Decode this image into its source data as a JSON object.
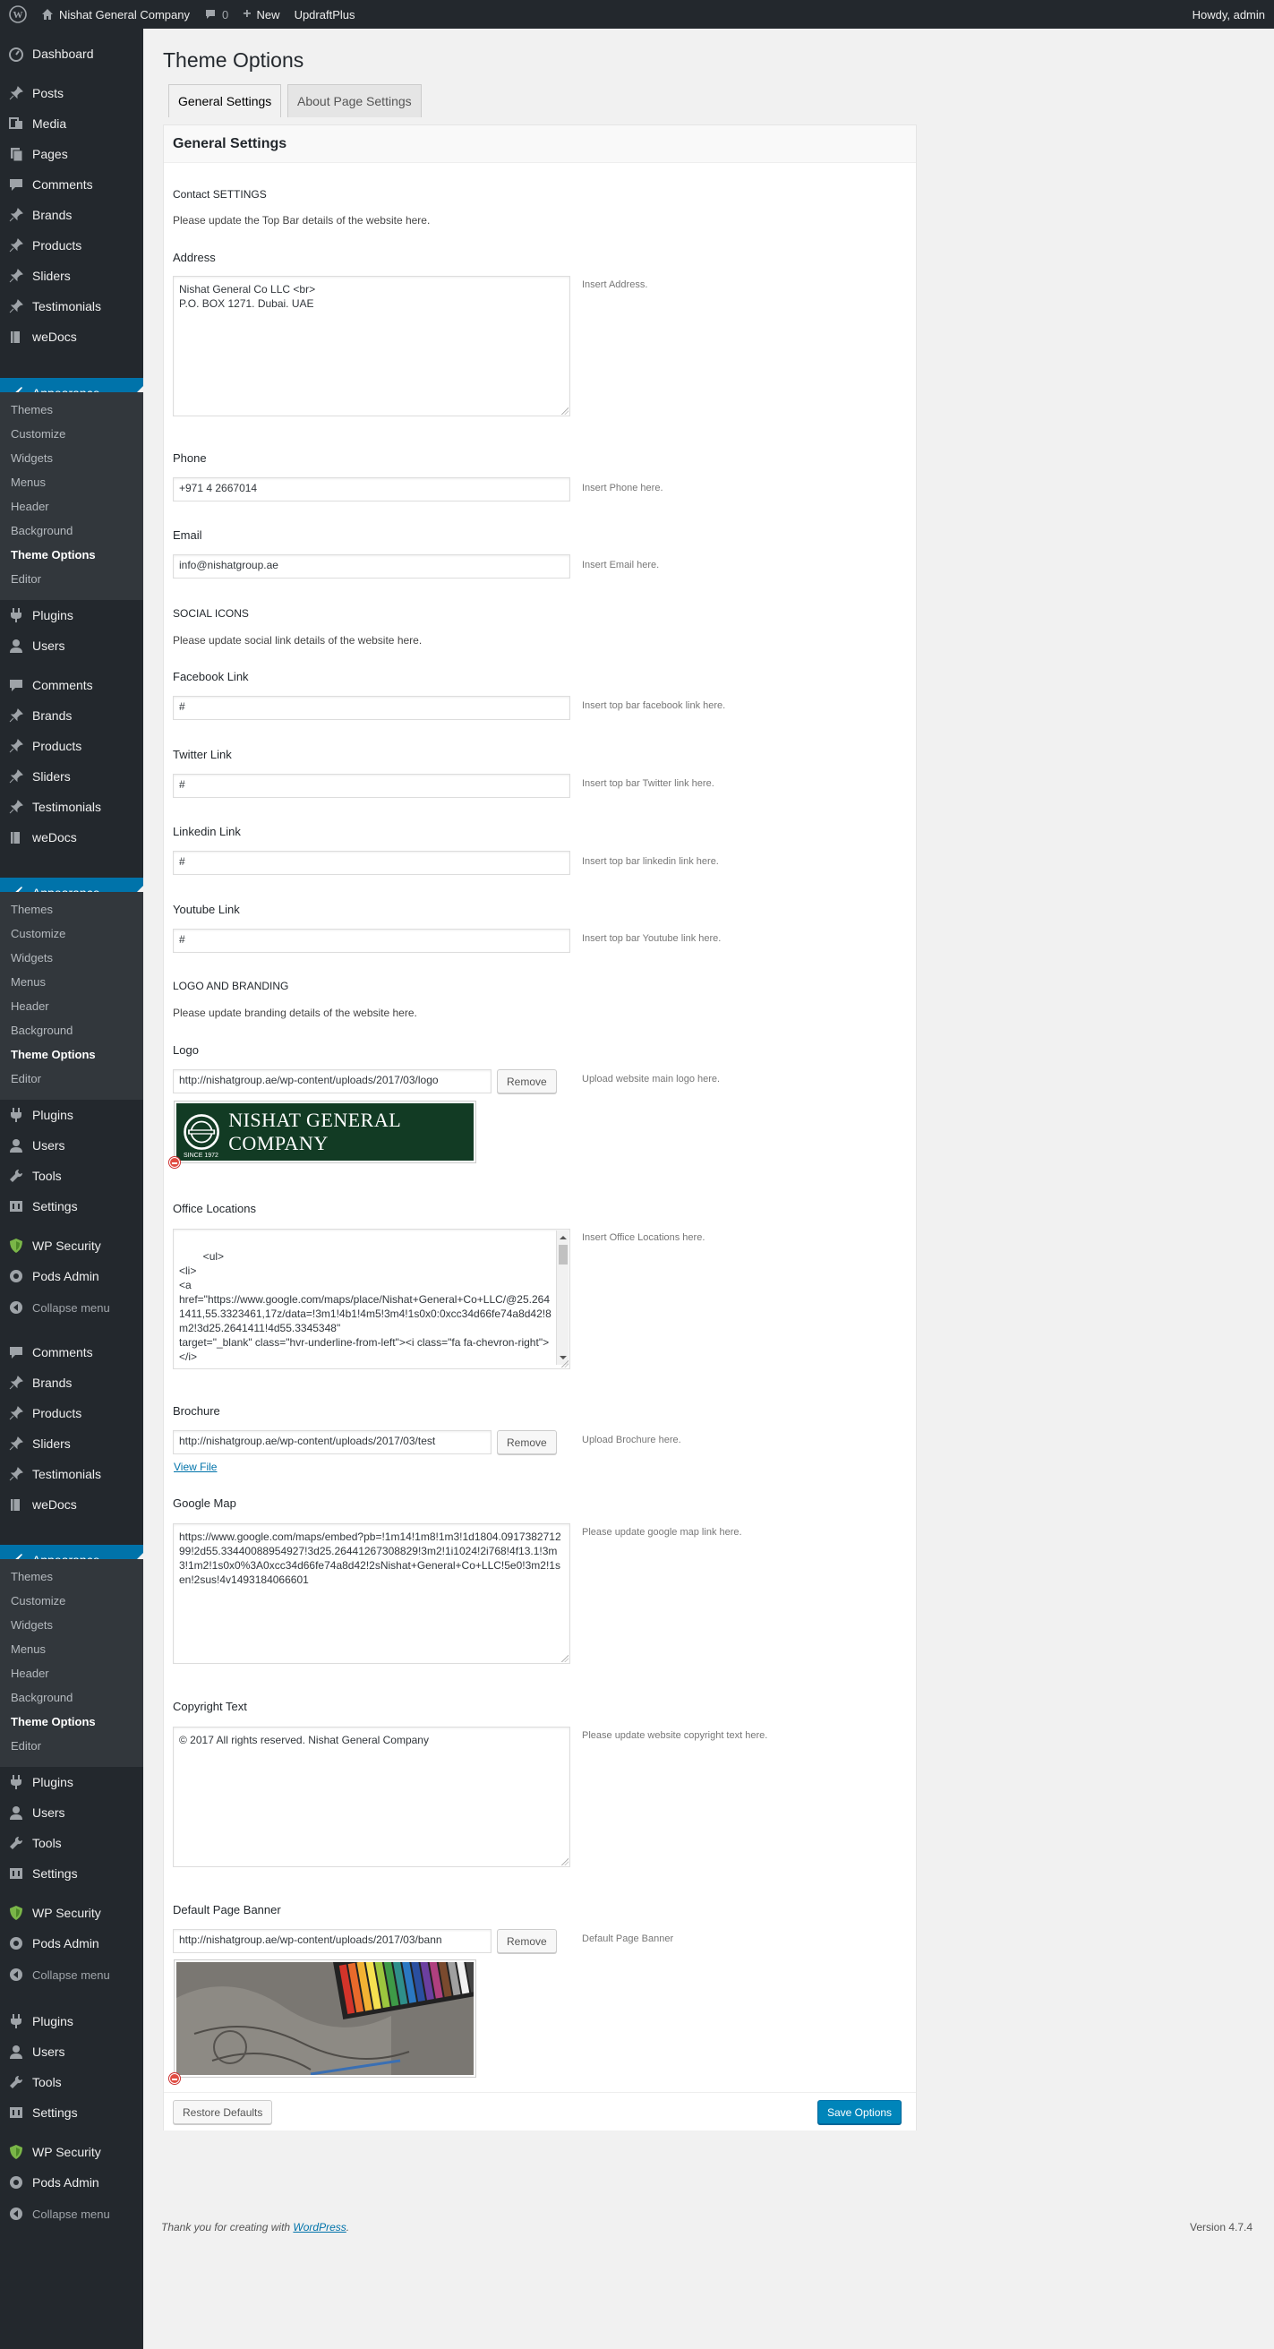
{
  "adminbar": {
    "site_name": "Nishat General Company",
    "comments_count": "0",
    "new_label": "New",
    "plugin_label": "UpdraftPlus",
    "howdy": "Howdy, admin"
  },
  "sidebar": {
    "group1": [
      "Dashboard",
      "Posts",
      "Media",
      "Pages",
      "Comments",
      "Brands",
      "Products",
      "Sliders",
      "Testimonials",
      "weDocs"
    ],
    "appearance": "Appearance",
    "submenu": [
      "Themes",
      "Customize",
      "Widgets",
      "Menus",
      "Header",
      "Background",
      "Theme Options",
      "Editor"
    ],
    "plugins": "Plugins",
    "users": "Users",
    "group2": [
      "Comments",
      "Brands",
      "Products",
      "Sliders",
      "Testimonials",
      "weDocs"
    ],
    "tools": "Tools",
    "settings": "Settings",
    "wp_security": "WP Security",
    "pods_admin": "Pods Admin",
    "collapse": "Collapse menu"
  },
  "page": {
    "title": "Theme Options",
    "tabs": [
      "General Settings",
      "About Page Settings"
    ],
    "panel_title": "General Settings"
  },
  "form": {
    "contact_heading": "Contact SETTINGS",
    "contact_desc": "Please update the Top Bar details of the website here.",
    "address_label": "Address",
    "address_value": "Nishat General Co LLC <br>\nP.O. BOX 1271. Dubai. UAE",
    "address_hint": "Insert Address.",
    "phone_label": "Phone",
    "phone_value": "+971 4 2667014",
    "phone_hint": "Insert Phone here.",
    "email_label": "Email",
    "email_value": "info@nishatgroup.ae",
    "email_hint": "Insert Email here.",
    "social_heading": "SOCIAL ICONS",
    "social_desc": "Please update social link details of the website here.",
    "facebook_label": "Facebook Link",
    "facebook_value": "#",
    "facebook_hint": "Insert top bar facebook link here.",
    "twitter_label": "Twitter Link",
    "twitter_value": "#",
    "twitter_hint": "Insert top bar Twitter link here.",
    "linkedin_label": "Linkedin Link",
    "linkedin_value": "#",
    "linkedin_hint": "Insert top bar linkedin link here.",
    "youtube_label": "Youtube Link",
    "youtube_value": "#",
    "youtube_hint": "Insert top bar Youtube link here.",
    "logo_heading": "LOGO AND BRANDING",
    "logo_desc": "Please update branding details of the website here.",
    "logo_label": "Logo",
    "logo_value": "http://nishatgroup.ae/wp-content/uploads/2017/03/logo",
    "logo_hint": "Upload website main logo here.",
    "logo_text": "NISHAT GENERAL COMPANY",
    "logo_since": "SINCE 1972",
    "remove_label": "Remove",
    "office_label": "Office Locations",
    "office_value": "  <ul>\n<li>\n<a\nhref=\"https://www.google.com/maps/place/Nishat+General+Co+LLC/@25.2641411,55.3323461,17z/data=!3m1!4b1!4m5!3m4!1s0x0:0xcc34d66fe74a8d42!8m2!3d25.2641411!4d55.3345348\"\ntarget=\"_blank\" class=\"hvr-underline-from-left\"><i class=\"fa fa-chevron-right\"></i>",
    "office_hint": "Insert Office Locations here.",
    "brochure_label": "Brochure",
    "brochure_value": "http://nishatgroup.ae/wp-content/uploads/2017/03/test",
    "brochure_hint": "Upload Brochure here.",
    "view_file": "View File",
    "map_label": "Google Map",
    "map_value": "https://www.google.com/maps/embed?pb=!1m14!1m8!1m3!1d1804.091738271299!2d55.33440088954927!3d25.26441267308829!3m2!1i1024!2i768!4f13.1!3m3!1m2!1s0x0%3A0xcc34d66fe74a8d42!2sNishat+General+Co+LLC!5e0!3m2!1sen!2sus!4v1493184066601",
    "map_hint": "Please update google map link here.",
    "copyright_label": "Copyright Text",
    "copyright_value": "© 2017 All rights reserved. Nishat General Company",
    "copyright_hint": "Please update website copyright text here.",
    "banner_label": "Default Page Banner",
    "banner_value": "http://nishatgroup.ae/wp-content/uploads/2017/03/bann",
    "banner_hint": "Default Page Banner"
  },
  "actions": {
    "restore": "Restore Defaults",
    "save": "Save Options"
  },
  "footer": {
    "thanks": "Thank you for creating with ",
    "wordpress": "WordPress",
    "period": ".",
    "version": "Version 4.7.4"
  },
  "colors": {
    "admin_dark": "#23282d",
    "submenu_bg": "#32373c",
    "accent_blue": "#0073aa",
    "button_primary": "#0085ba",
    "logo_green": "#123b24"
  }
}
